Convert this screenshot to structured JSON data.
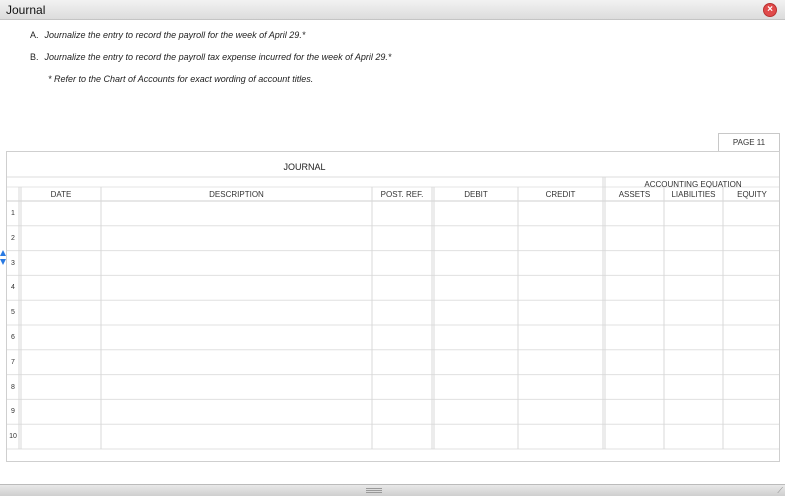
{
  "window": {
    "title": "Journal",
    "close_label": "×"
  },
  "instructions": {
    "a_label": "A.",
    "a_text": "Journalize the entry to record the payroll for the week of April 29.*",
    "b_label": "B.",
    "b_text": "Journalize the entry to record the payroll tax expense incurred for the week of April 29.*",
    "note": "* Refer to the Chart of Accounts for exact wording of account titles."
  },
  "page_tab": "PAGE 11",
  "journal": {
    "title": "JOURNAL",
    "columns": {
      "date": "DATE",
      "description": "DESCRIPTION",
      "post_ref": "POST. REF.",
      "debit": "DEBIT",
      "credit": "CREDIT",
      "accounting_equation": "ACCOUNTING EQUATION",
      "assets": "ASSETS",
      "liabilities": "LIABILITIES",
      "equity": "EQUITY"
    },
    "row_numbers": [
      "1",
      "2",
      "3",
      "4",
      "5",
      "6",
      "7",
      "8",
      "9",
      "10"
    ]
  },
  "icons": {
    "close": "close-icon",
    "row_spinner": "up-down-arrow-icon",
    "resize_grip": "resize-grip-icon"
  },
  "colors": {
    "close_button": "#e04a4a",
    "spinner": "#2a7ae2",
    "grid_line": "#dcdcdc"
  }
}
